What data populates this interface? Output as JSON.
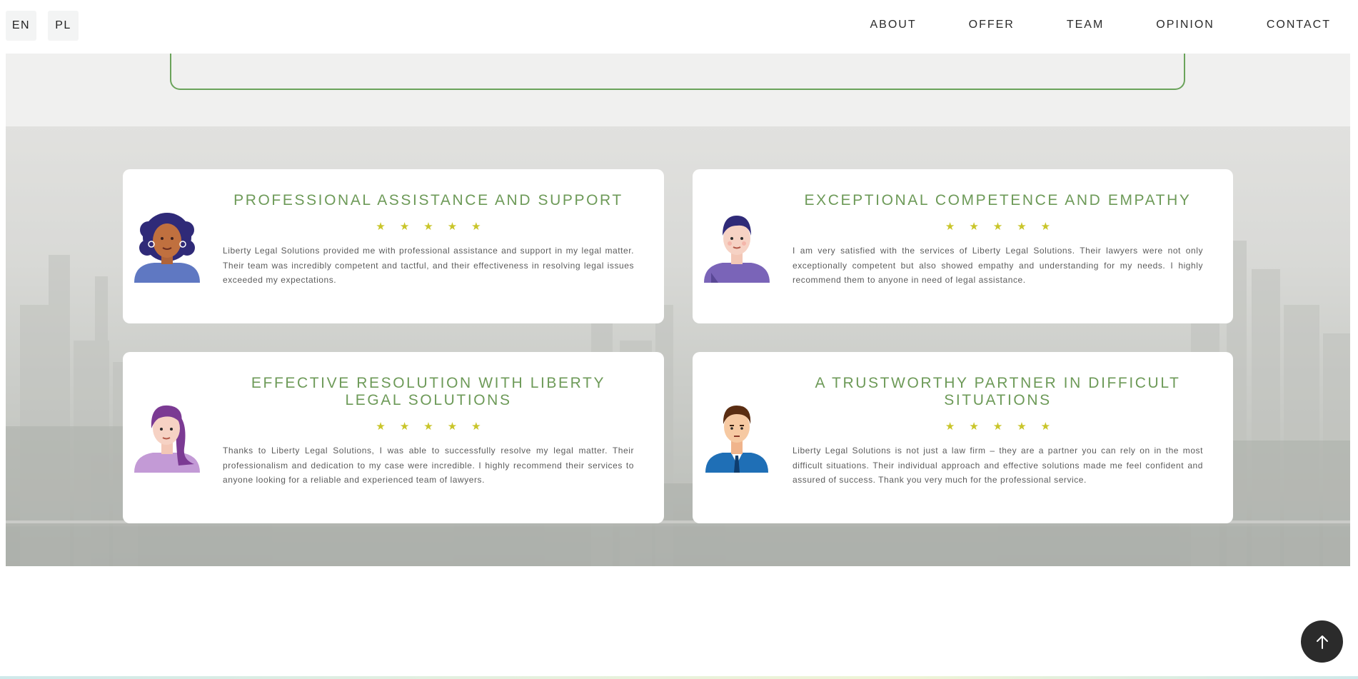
{
  "header": {
    "languages": [
      {
        "label": "EN"
      },
      {
        "label": "PL"
      }
    ],
    "nav": [
      {
        "label": "ABOUT"
      },
      {
        "label": "OFFER"
      },
      {
        "label": "TEAM"
      },
      {
        "label": "OPINION"
      },
      {
        "label": "CONTACT"
      }
    ]
  },
  "colors": {
    "accent_green": "#6d9a58",
    "star_yellow": "#c9c52a",
    "box_border": "#6aa35a",
    "back_to_top": "#2b2b2b"
  },
  "testimonials": [
    {
      "title": "PROFESSIONAL ASSISTANCE AND SUPPORT",
      "rating": 5,
      "text": "Liberty Legal Solutions provided me with professional assistance and support in my legal matter. Their team was incredibly competent and tactful, and their effectiveness in resolving legal issues exceeded my expectations.",
      "avatar": "woman-curly-hair-avatar"
    },
    {
      "title": "EXCEPTIONAL COMPETENCE AND EMPATHY",
      "rating": 5,
      "text": "I am very satisfied with the services of Liberty Legal Solutions. Their lawyers were not only exceptionally competent but also showed empathy and understanding for my needs. I highly recommend them to anyone in need of legal assistance.",
      "avatar": "young-man-avatar"
    },
    {
      "title": "EFFECTIVE RESOLUTION WITH LIBERTY LEGAL SOLUTIONS",
      "rating": 5,
      "text": "Thanks to Liberty Legal Solutions, I was able to successfully resolve my legal matter. Their professionalism and dedication to my case were incredible. I highly recommend their services to anyone looking for a reliable and experienced team of lawyers.",
      "avatar": "woman-purple-hair-avatar"
    },
    {
      "title": "A TRUSTWORTHY PARTNER IN DIFFICULT SITUATIONS",
      "rating": 5,
      "text": "Liberty Legal Solutions is not just a law firm – they are a partner you can rely on in the most difficult situations. Their individual approach and effective solutions made me feel confident and assured of success. Thank you very much for the professional service.",
      "avatar": "businessman-avatar"
    }
  ],
  "back_to_top": {
    "icon": "arrow-up-icon"
  }
}
